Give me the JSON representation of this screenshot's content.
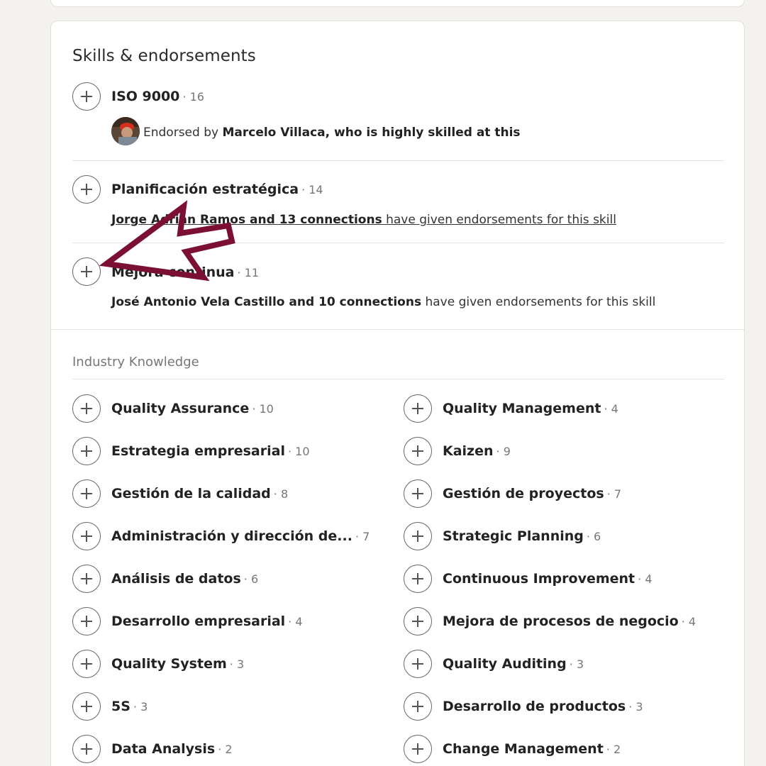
{
  "section": {
    "title": "Skills & endorsements"
  },
  "top_skills": [
    {
      "name": "ISO 9000",
      "count": "· 16"
    },
    {
      "name": "Planificación estratégica",
      "count": "· 14"
    },
    {
      "name": "Mejora continua",
      "count": "· 11"
    }
  ],
  "endorsements": {
    "iso": {
      "prefix": "Endorsed by ",
      "person": "Marcelo Villaca, who is highly skilled at this"
    },
    "planificacion": {
      "people": "Jorge Adrián Ramos and 13 connections",
      "suffix": " have given endorsements for this skill"
    },
    "mejora": {
      "people": "José Antonio Vela Castillo and 10 connections",
      "suffix": " have given endorsements for this skill"
    }
  },
  "industry": {
    "heading": "Industry Knowledge",
    "left": [
      {
        "name": "Quality Assurance",
        "count": "· 10"
      },
      {
        "name": "Estrategia empresarial",
        "count": "· 10"
      },
      {
        "name": "Gestión de la calidad",
        "count": "· 8"
      },
      {
        "name": "Administración y dirección de...",
        "count": "· 7"
      },
      {
        "name": "Análisis de datos",
        "count": "· 6"
      },
      {
        "name": "Desarrollo empresarial",
        "count": "· 4"
      },
      {
        "name": "Quality System",
        "count": "· 3"
      },
      {
        "name": "5S",
        "count": "· 3"
      },
      {
        "name": "Data Analysis",
        "count": "· 2"
      }
    ],
    "right": [
      {
        "name": "Quality Management",
        "count": "· 4"
      },
      {
        "name": "Kaizen",
        "count": "· 9"
      },
      {
        "name": "Gestión de proyectos",
        "count": "· 7"
      },
      {
        "name": "Strategic Planning",
        "count": "· 6"
      },
      {
        "name": "Continuous Improvement",
        "count": "· 4"
      },
      {
        "name": "Mejora de procesos de negocio",
        "count": "· 4"
      },
      {
        "name": "Quality Auditing",
        "count": "· 3"
      },
      {
        "name": "Desarrollo de productos",
        "count": "· 3"
      },
      {
        "name": "Change Management",
        "count": "· 2"
      }
    ]
  },
  "colors": {
    "arrow": "#7b1034",
    "background": "#f3f2ef",
    "card": "#ffffff"
  },
  "icons": {
    "plus": "plus-icon",
    "arrow": "arrow-annotation"
  }
}
